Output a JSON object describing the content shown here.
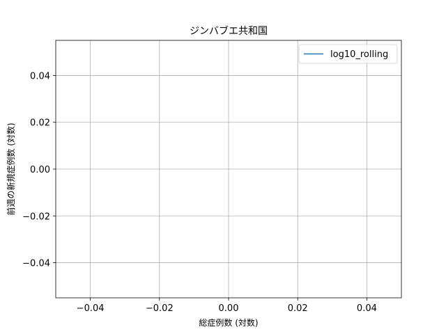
{
  "chart_data": {
    "type": "line",
    "title": "ジンバブエ共和国",
    "xlabel": "総症例数 (対数)",
    "ylabel": "前週の新規症例数 (対数)",
    "xlim": [
      -0.05,
      0.05
    ],
    "ylim": [
      -0.055,
      0.055
    ],
    "x_ticks": [
      -0.04,
      -0.02,
      0.0,
      0.02,
      0.04
    ],
    "y_ticks": [
      -0.04,
      -0.02,
      0.0,
      0.02,
      0.04
    ],
    "x_tick_labels": [
      "−0.04",
      "−0.02",
      "0.00",
      "0.02",
      "0.04"
    ],
    "y_tick_labels": [
      "−0.04",
      "−0.02",
      "0.00",
      "0.02",
      "0.04"
    ],
    "grid": true,
    "legend_position": "top-right",
    "series": [
      {
        "name": "log10_rolling",
        "color": "#1f77b4",
        "x": [],
        "y": []
      }
    ]
  }
}
